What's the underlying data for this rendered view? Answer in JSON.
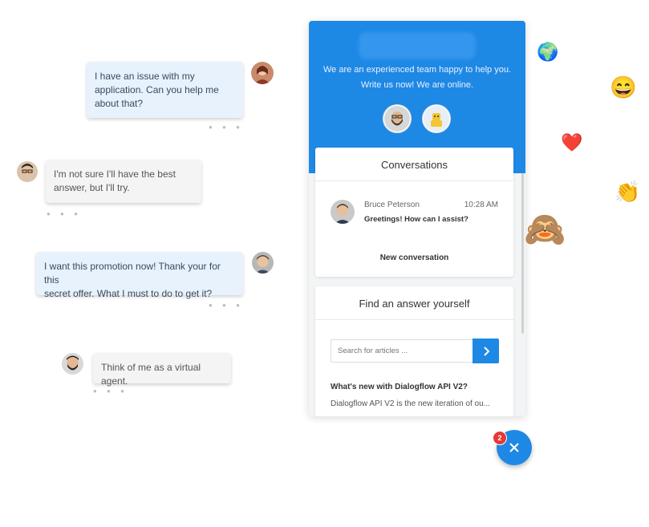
{
  "chat_samples": [
    {
      "text_lines": [
        "I have an issue with my",
        "application. Can you help me",
        "about that?"
      ],
      "style": "blue",
      "side": "right"
    },
    {
      "text_lines": [
        "I'm not sure I'll have the best",
        "answer, but I'll try."
      ],
      "style": "gray",
      "side": "left"
    },
    {
      "text_lines": [
        "I want this promotion now! Thank your for this",
        "secret offer. What I must to do to get it?"
      ],
      "style": "blue",
      "side": "right"
    },
    {
      "text_lines": [
        "Think of me as a virtual agent."
      ],
      "style": "gray",
      "side": "left"
    }
  ],
  "widget": {
    "header_line1": "We are an experienced team happy to help you.",
    "header_line2": "Write us now! We are online.",
    "conversations": {
      "title": "Conversations",
      "item": {
        "name": "Bruce Peterson",
        "time": "10:28 AM",
        "message": "Greetings! How can I assist?"
      },
      "new_button": "New conversation"
    },
    "find_answer": {
      "title": "Find an answer yourself",
      "search_placeholder": "Search for articles ...",
      "article_title": "What's new with Dialogflow API V2?",
      "article_desc": "Dialogflow API V2 is the new iteration of ou..."
    }
  },
  "fab": {
    "badge_count": "2",
    "icon": "close-icon"
  },
  "colors": {
    "brand": "#1e88e5",
    "badge": "#e53935"
  }
}
